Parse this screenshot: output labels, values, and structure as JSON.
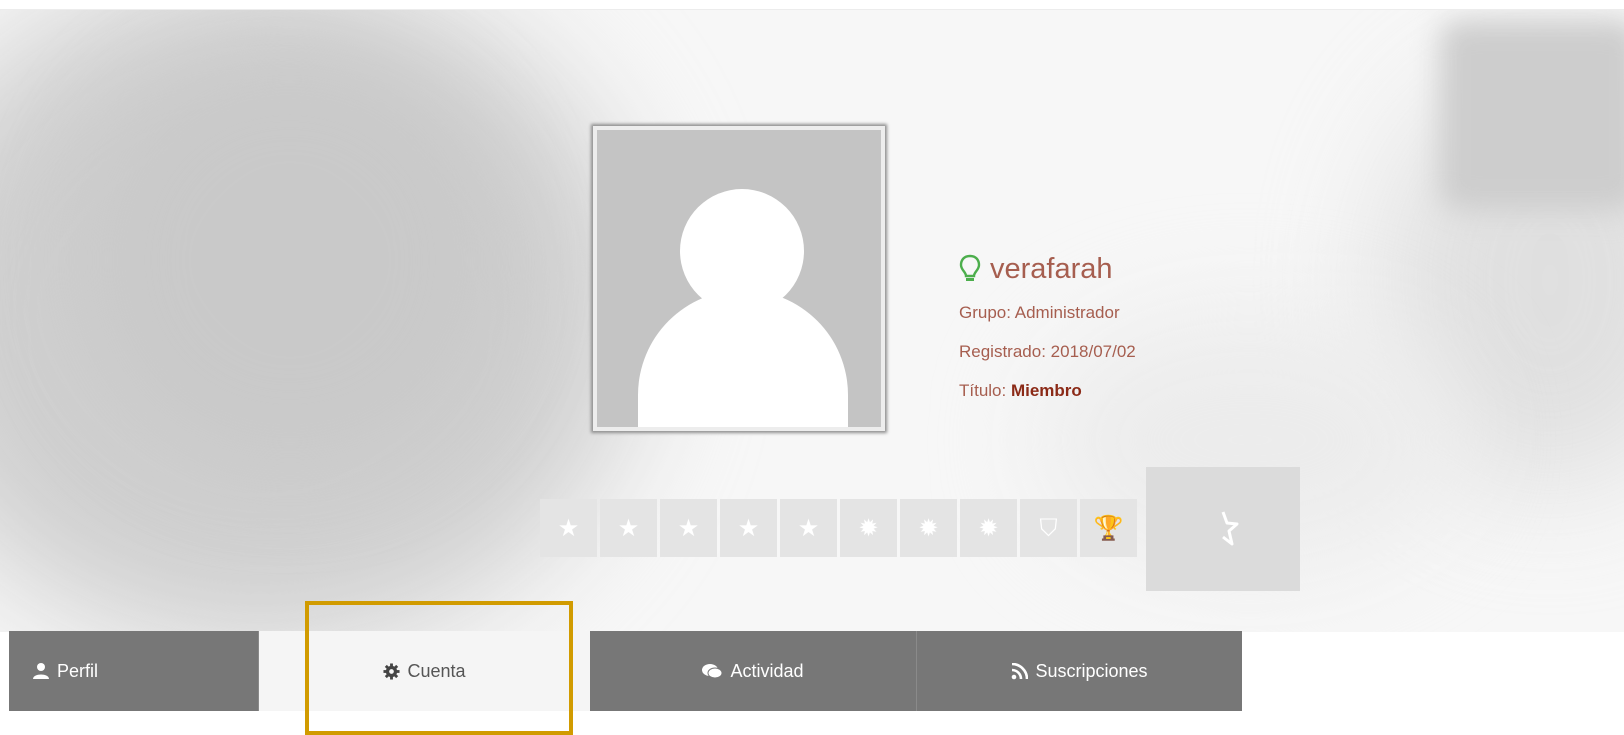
{
  "profile": {
    "username": "verafarah",
    "group": "Grupo: Administrador",
    "registered": "Registrado: 2018/07/02",
    "title_label": "Título: ",
    "title_value": "Miembro"
  },
  "badges": [
    {
      "icon": "star-icon",
      "glyph": "★"
    },
    {
      "icon": "star-icon",
      "glyph": "★"
    },
    {
      "icon": "star-icon",
      "glyph": "★"
    },
    {
      "icon": "star-icon",
      "glyph": "★"
    },
    {
      "icon": "star-icon",
      "glyph": "★"
    },
    {
      "icon": "cog-badge-icon",
      "glyph": "✹"
    },
    {
      "icon": "cog-badge-icon",
      "glyph": "✹"
    },
    {
      "icon": "cog-badge-icon",
      "glyph": "✹"
    },
    {
      "icon": "shield-icon",
      "glyph": "⛉"
    },
    {
      "icon": "trophy-icon",
      "glyph": "🏆"
    }
  ],
  "tabs": [
    {
      "label": "Perfil",
      "icon": "user-icon",
      "active": false
    },
    {
      "label": "Cuenta",
      "icon": "gear-icon",
      "active": true
    },
    {
      "label": "Actividad",
      "icon": "comments-icon",
      "active": false
    },
    {
      "label": "Suscripciones",
      "icon": "rss-icon",
      "active": false
    }
  ],
  "colors": {
    "username": "#a65e4f",
    "title_value": "#8b2a17",
    "tab_bg": "#777777",
    "tab_active_bg": "#f5f5f5",
    "highlight": "#d19b00",
    "online_icon": "#4cae4c"
  }
}
